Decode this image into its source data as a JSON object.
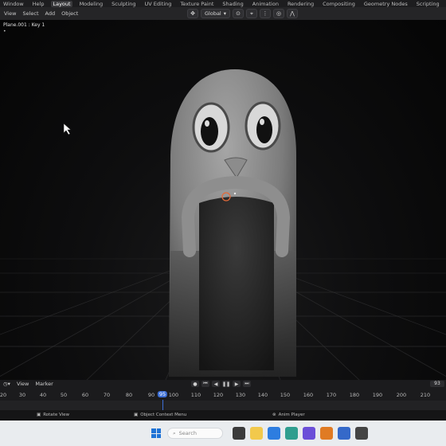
{
  "topbar": {
    "workspaces": [
      "Window",
      "Help",
      "Layout",
      "Modeling",
      "Sculpting",
      "UV Editing",
      "Texture Paint",
      "Shading",
      "Animation",
      "Rendering",
      "Compositing",
      "Geometry Nodes",
      "Scripting"
    ],
    "active_index": 2,
    "add_label": "+"
  },
  "header": {
    "menus": [
      "View",
      "Select",
      "Add",
      "Object"
    ],
    "orientation": "Global"
  },
  "viewport": {
    "object_title": "Plane.001 : Key 1"
  },
  "timeline": {
    "menus": [
      "View",
      "Marker"
    ],
    "ticks": [
      "20",
      "30",
      "40",
      "50",
      "60",
      "70",
      "80",
      "90",
      "100",
      "110",
      "120",
      "130",
      "140",
      "150",
      "160",
      "170",
      "180",
      "190",
      "200",
      "210"
    ],
    "current_frame": "95",
    "frame_field": "93"
  },
  "status": {
    "rotate": "Rotate View",
    "context_menu": "Object Context Menu",
    "anim_player": "Anim Player"
  },
  "taskbar": {
    "search_placeholder": "Search"
  },
  "colors": {
    "accent": "#3d6fd6",
    "background": "#0b0b0c",
    "character": "#9a9a9a"
  }
}
